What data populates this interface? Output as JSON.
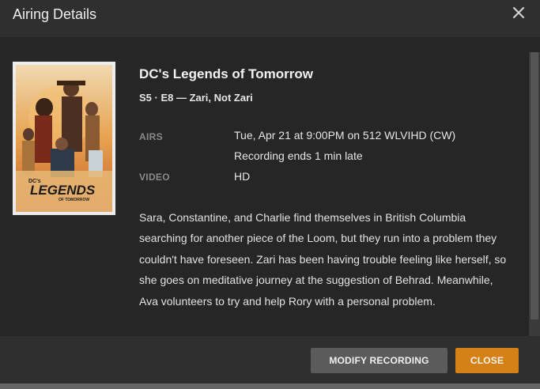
{
  "header": {
    "title": "Airing Details"
  },
  "show": {
    "title": "DC's Legends of Tomorrow",
    "episode": "S5 · E8 — Zari, Not Zari",
    "poster": {
      "logo_text": "LEGENDS",
      "logo_prefix": "DC's",
      "logo_suffix": "OF TOMORROW"
    }
  },
  "details": {
    "airs_label": "AIRS",
    "airs_value": "Tue, Apr 21 at 9:00PM on 512 WLVIHD (CW)",
    "recording_note": "Recording ends 1 min late",
    "video_label": "VIDEO",
    "video_value": "HD"
  },
  "description": "Sara, Constantine, and Charlie find themselves in British Columbia searching for another piece of the Loom, but they run into a problem they couldn't have foreseen. Zari has been having trouble feeling like herself, so she goes on meditative journey at the suggestion of Behrad. Meanwhile, Ava volunteers to try and help Rory with a personal problem.",
  "buttons": {
    "modify": "MODIFY RECORDING",
    "close": "CLOSE"
  },
  "colors": {
    "accent": "#d48215",
    "panel": "#262626",
    "header": "#2f2f2f"
  }
}
